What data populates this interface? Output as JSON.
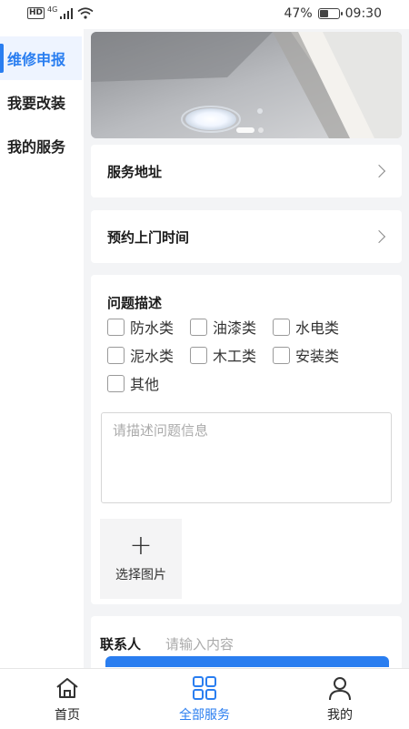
{
  "status_bar": {
    "network": "4G",
    "battery": "47%",
    "battery_level": 0.47,
    "time": "09:30"
  },
  "sidebar": {
    "items": [
      {
        "label": "维修申报",
        "active": true
      },
      {
        "label": "我要改装",
        "active": false
      },
      {
        "label": "我的服务",
        "active": false
      }
    ]
  },
  "banner": {
    "slides": 2,
    "active_index": 0
  },
  "form": {
    "service_address": "服务地址",
    "appointment_time": "预约上门时间",
    "issue": {
      "title": "问题描述",
      "options": [
        "防水类",
        "油漆类",
        "水电类",
        "泥水类",
        "木工类",
        "安装类",
        "其他"
      ],
      "placeholder": "请描述问题信息"
    },
    "upload_label": "选择图片",
    "contact": {
      "label": "联系人",
      "placeholder": "请输入内容"
    }
  },
  "tabbar": {
    "items": [
      {
        "label": "首页",
        "icon": "home-icon",
        "active": false
      },
      {
        "label": "全部服务",
        "icon": "grid-icon",
        "active": true
      },
      {
        "label": "我的",
        "icon": "user-icon",
        "active": false
      }
    ]
  },
  "colors": {
    "accent": "#2a7ef0",
    "background": "#f3f4f6",
    "card": "#ffffff"
  }
}
